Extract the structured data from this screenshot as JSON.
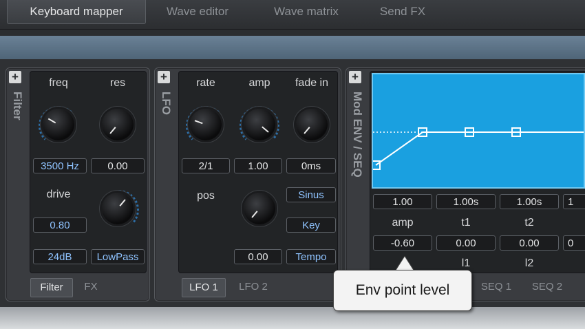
{
  "top_tabs": [
    "Keyboard mapper",
    "Wave editor",
    "Wave matrix",
    "Send FX"
  ],
  "filter": {
    "title": "Filter",
    "freq_label": "freq",
    "res_label": "res",
    "freq_value": "3500 Hz",
    "res_value": "0.00",
    "drive_label": "drive",
    "drive_value": "0.80",
    "slope_value": "24dB",
    "type_value": "LowPass",
    "tabs": [
      "Filter",
      "FX"
    ]
  },
  "lfo": {
    "title": "LFO",
    "rate_label": "rate",
    "amp_label": "amp",
    "fade_label": "fade in",
    "rate_value": "2/1",
    "amp_value": "1.00",
    "fade_value": "0ms",
    "pos_label": "pos",
    "shape_value": "Sinus",
    "trigger_value": "Key",
    "pos_value": "0.00",
    "sync_value": "Tempo",
    "tabs": [
      "LFO 1",
      "LFO 2"
    ]
  },
  "modenv": {
    "title": "Mod ENV / SEQ",
    "top_values": [
      "1.00",
      "1.00s",
      "1.00s",
      "1"
    ],
    "col_labels": [
      "amp",
      "t1",
      "t2"
    ],
    "bottom_values": [
      "-0.60",
      "0.00",
      "0.00",
      "0"
    ],
    "lower_labels": [
      "l1",
      "l2"
    ],
    "tabs": [
      "SEQ 1",
      "SEQ 2"
    ]
  },
  "tooltip": {
    "text": "Env point level"
  },
  "colors": {
    "accent_blue": "#1aa0e0",
    "value_text": "#8fc3ff"
  }
}
